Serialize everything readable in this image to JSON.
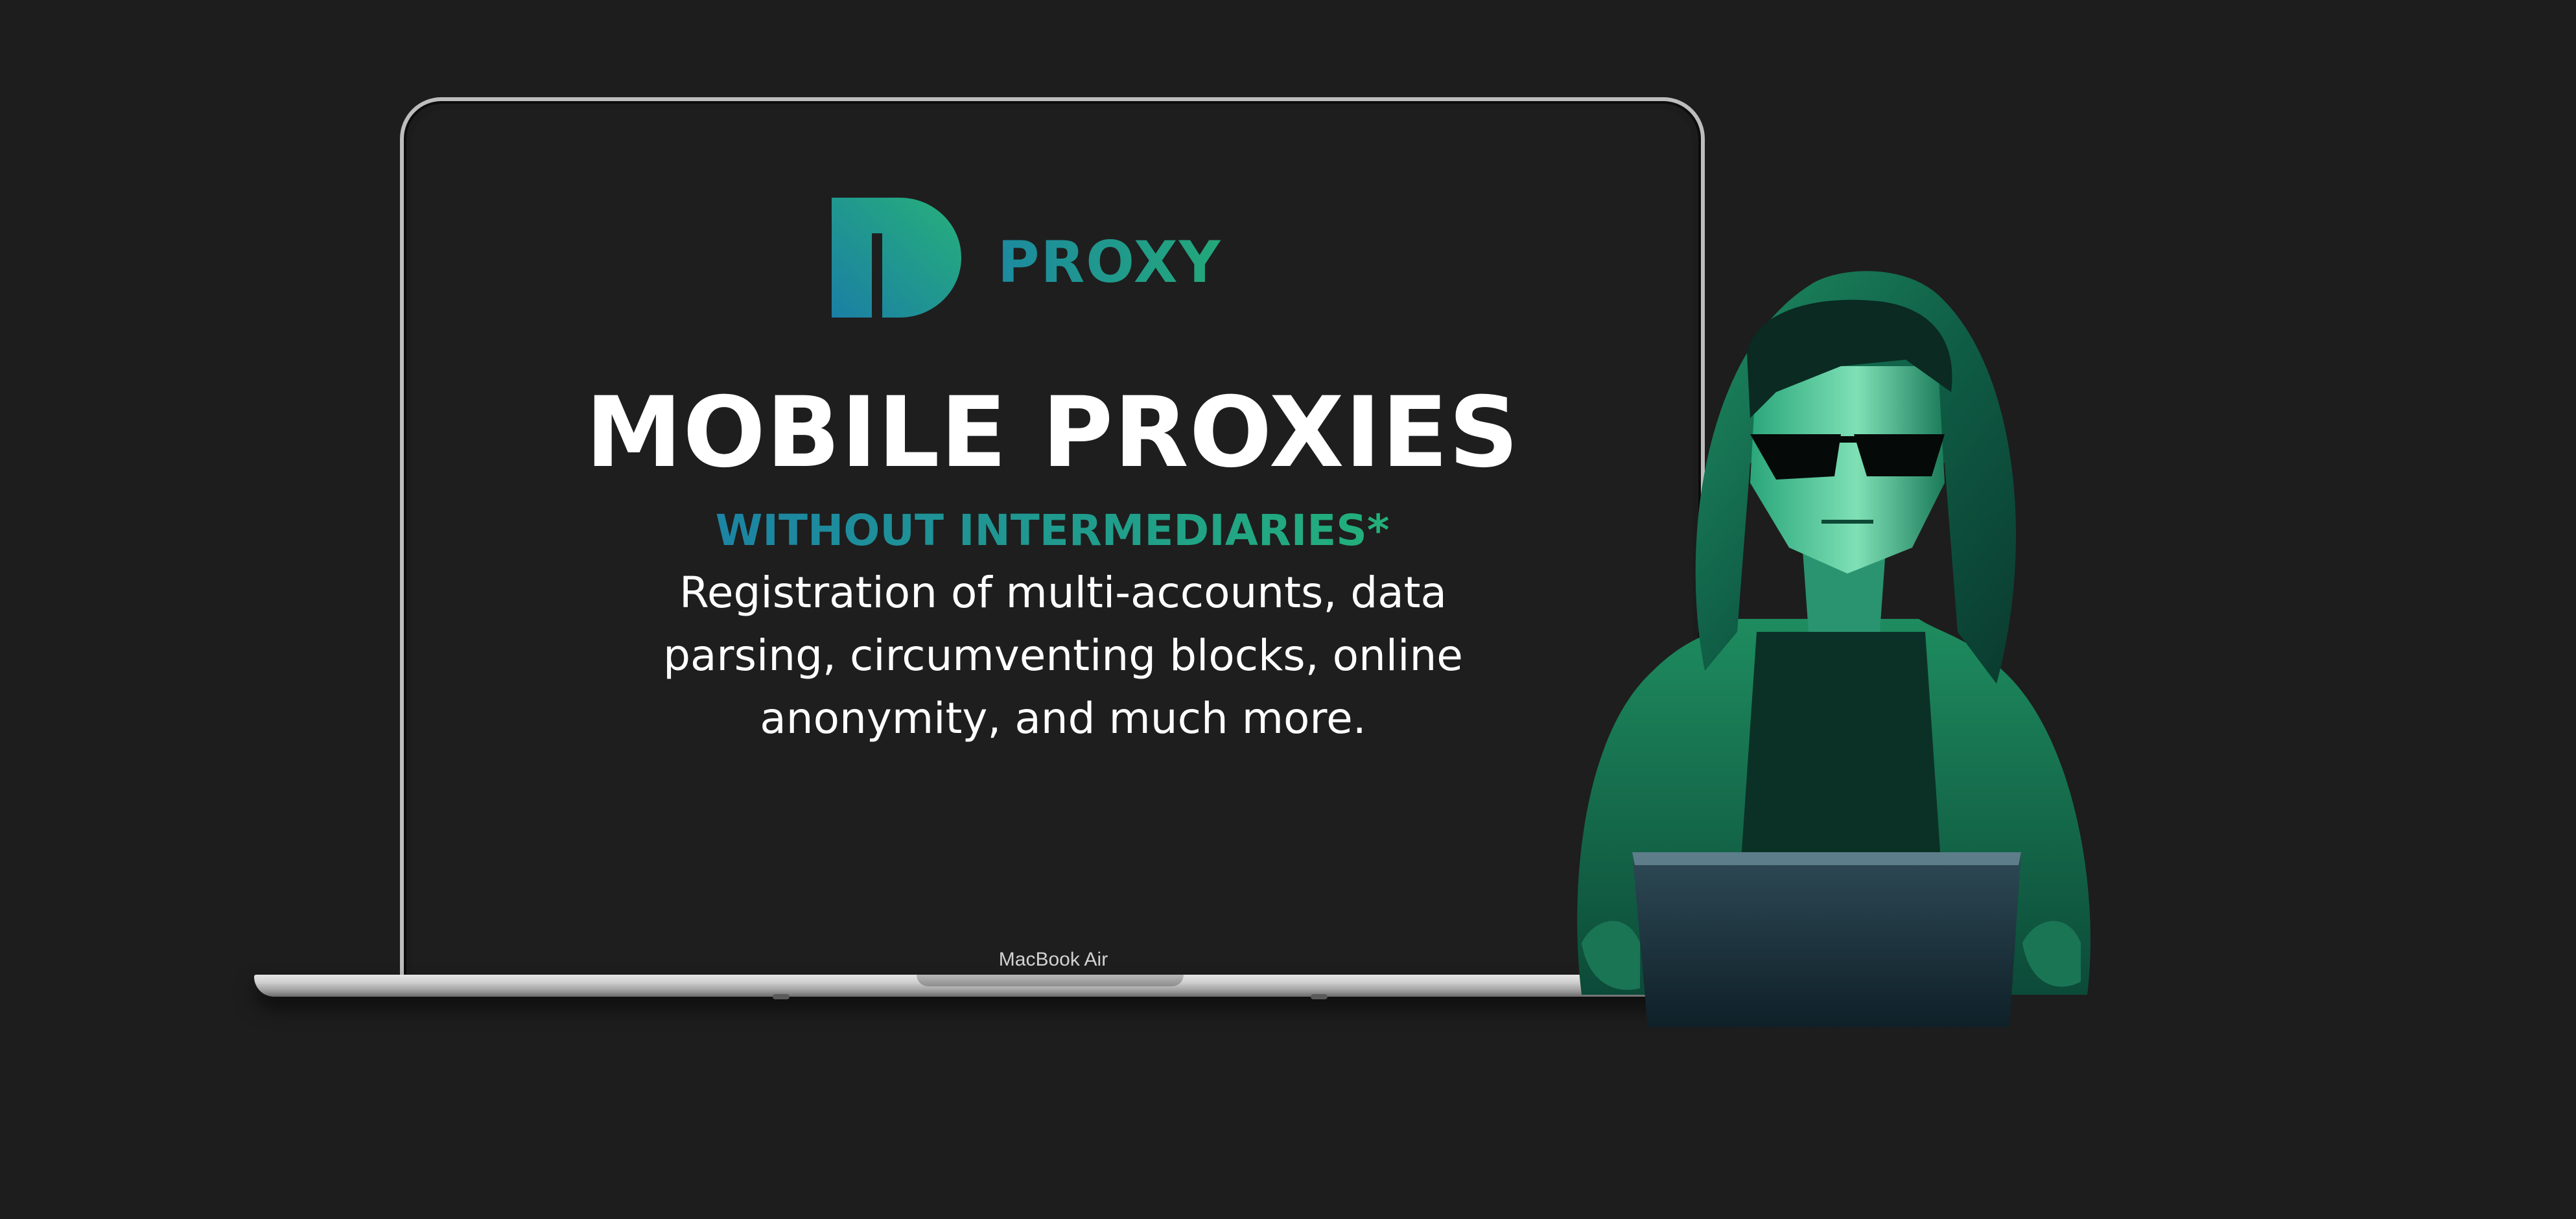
{
  "colors": {
    "background": "#1d1d1d",
    "brand_teal": "#1c8aa0",
    "brand_green": "#24a879",
    "headline": "#ffffff"
  },
  "logo": {
    "text": "PROXY",
    "mark_icon": "d-letter-logo-icon"
  },
  "hero": {
    "title": "MOBILE PROXIES",
    "subtitle": "WITHOUT INTERMEDIARIES*",
    "description": "Registration of multi-accounts, data parsing, circumventing blocks, online anonymity, and much more."
  },
  "device": {
    "model_label": "MacBook Air"
  },
  "illustration": {
    "icon": "hooded-hacker-illustration"
  }
}
